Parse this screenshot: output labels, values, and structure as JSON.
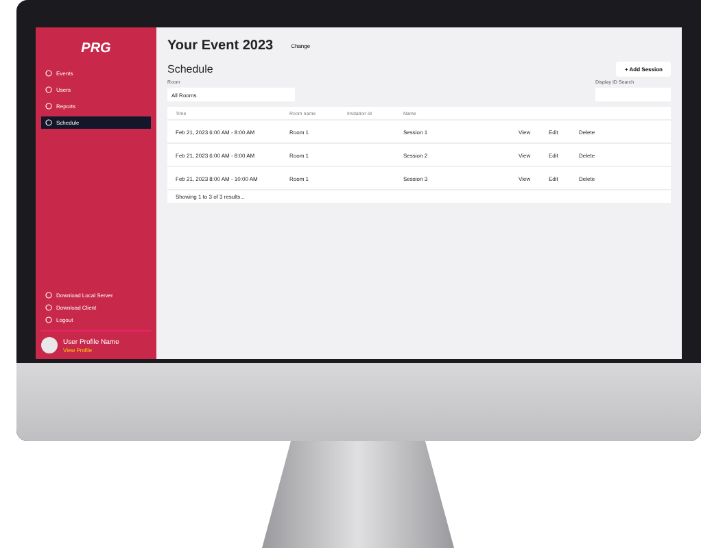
{
  "sidebar": {
    "logo": "PRG",
    "nav": [
      {
        "label": "Events",
        "selected": false
      },
      {
        "label": "Users",
        "selected": false
      },
      {
        "label": "Reports",
        "selected": false
      },
      {
        "label": "Schedule",
        "selected": true
      }
    ],
    "bottom": [
      "Download Local Server",
      "Download Client",
      "Logout"
    ],
    "profile": {
      "name": "User Profile Name",
      "link": "View Profile"
    }
  },
  "header": {
    "title": "Your Event 2023",
    "change": "Change"
  },
  "page": {
    "title": "Schedule",
    "add_button": "Add Session",
    "add_icon": "+",
    "room_label": "Room",
    "room_value": "All Rooms",
    "search_label": "Display ID Search"
  },
  "table": {
    "columns": [
      "Time",
      "Room name",
      "Invitation Id",
      "Name"
    ],
    "rows": [
      {
        "time": "Feb 21, 2023 6:00 AM - 8:00 AM",
        "room": "Room 1",
        "session": "Session 1",
        "actions": [
          "View",
          "Edit",
          "Delete"
        ]
      },
      {
        "time": "Feb 21, 2023 6:00 AM - 8:00 AM",
        "room": "Room 1",
        "session": "Session 2",
        "actions": [
          "View",
          "Edit",
          "Delete"
        ]
      },
      {
        "time": "Feb 21, 2023 8:00 AM - 10:00 AM",
        "room": "Room 1",
        "session": "Session 3",
        "actions": [
          "View",
          "Edit",
          "Delete"
        ]
      }
    ],
    "footer": "Showing 1 to 3 of 3 results..."
  }
}
